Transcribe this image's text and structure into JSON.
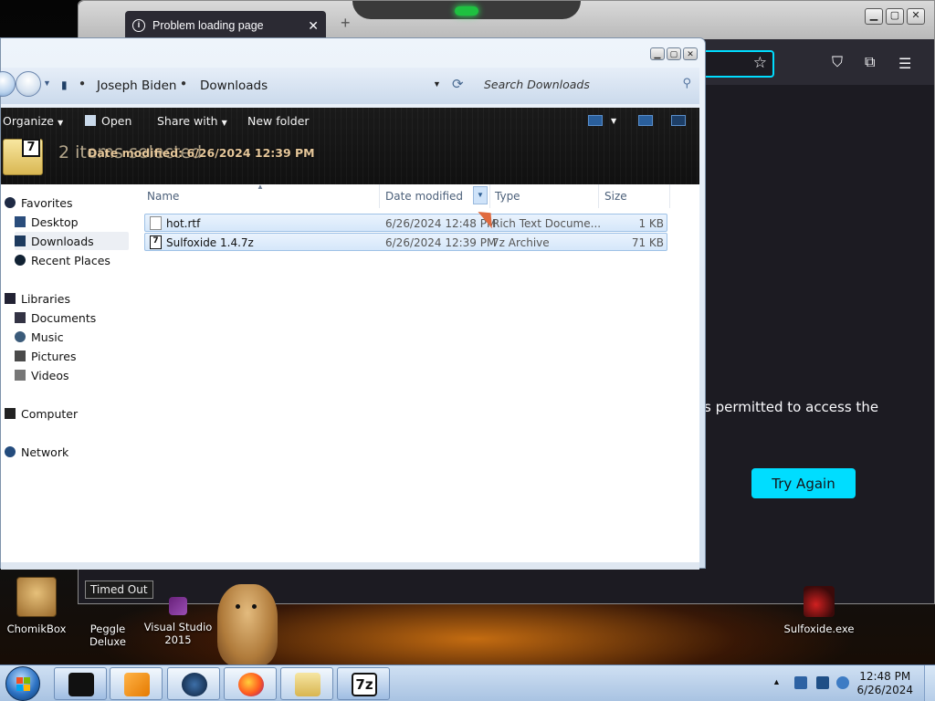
{
  "desktop": {
    "icons": [
      {
        "label": "ChomikBox"
      },
      {
        "label": "Peggle Deluxe"
      },
      {
        "label": "Visual Studio 2015"
      },
      {
        "label": "Sulfoxide.exe"
      }
    ],
    "tooltip": "Timed Out"
  },
  "firefox": {
    "tab_title": "Problem loading page",
    "message_fragment": "s permitted to access the",
    "try_again": "Try Again"
  },
  "explorer": {
    "breadcrumb": [
      "Joseph Biden",
      "Downloads"
    ],
    "search_placeholder": "Search Downloads",
    "commands": {
      "organize": "Organize",
      "open": "Open",
      "share_with": "Share with",
      "new_folder": "New folder"
    },
    "details": {
      "selection_count": "2 items selected",
      "meta": "Date modified: 6/26/2024 12:39 PM"
    },
    "nav": {
      "favorites": "Favorites",
      "desktop": "Desktop",
      "downloads": "Downloads",
      "recent_places": "Recent Places",
      "libraries": "Libraries",
      "documents": "Documents",
      "music": "Music",
      "pictures": "Pictures",
      "videos": "Videos",
      "computer": "Computer",
      "network": "Network"
    },
    "columns": {
      "name": "Name",
      "date_modified": "Date modified",
      "type": "Type",
      "size": "Size"
    },
    "files": [
      {
        "name": "hot.rtf",
        "date": "6/26/2024 12:48 PM",
        "type": "Rich Text Docume...",
        "size": "1 KB",
        "icon": "rtf-document-icon"
      },
      {
        "name": "Sulfoxide 1.4.7z",
        "date": "6/26/2024 12:39 PM",
        "type": "7z Archive",
        "size": "71 KB",
        "icon": "7z-archive-icon"
      }
    ]
  },
  "taskbar": {
    "clock_time": "12:48 PM",
    "clock_date": "6/26/2024"
  }
}
